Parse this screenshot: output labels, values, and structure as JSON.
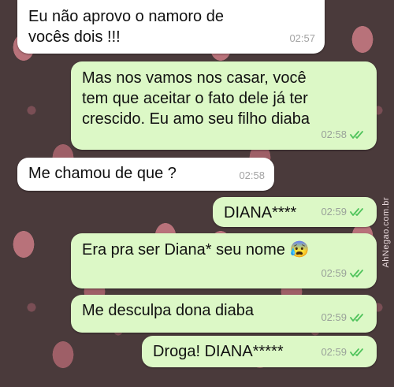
{
  "watermark": "AhNegao.com.br",
  "messages": [
    {
      "direction": "incoming",
      "text": "Eu não aprovo o namoro de\nvocês dois !!!",
      "time": "02:57"
    },
    {
      "direction": "outgoing",
      "text": "Mas nos vamos nos casar, você\ntem que aceitar o fato dele já ter\ncrescido. Eu amo seu filho diaba",
      "time": "02:58",
      "status_icon": "double-check-icon"
    },
    {
      "direction": "incoming",
      "text": "Me chamou de que ?",
      "time": "02:58"
    },
    {
      "direction": "outgoing",
      "text": "DIANA****",
      "time": "02:59",
      "status_icon": "double-check-icon"
    },
    {
      "direction": "outgoing",
      "text": "Era pra ser Diana* seu nome 😰",
      "time": "02:59",
      "status_icon": "double-check-icon"
    },
    {
      "direction": "outgoing",
      "text": "Me desculpa dona diaba",
      "time": "02:59",
      "status_icon": "double-check-icon"
    },
    {
      "direction": "outgoing",
      "text": "Droga! DIANA*****",
      "time": "02:59",
      "status_icon": "double-check-icon"
    }
  ],
  "colors": {
    "incoming_bubble": "#ffffff",
    "outgoing_bubble": "#dcf8c6",
    "tick_color": "#4fc35b",
    "wallpaper": "#4a3a3b"
  }
}
